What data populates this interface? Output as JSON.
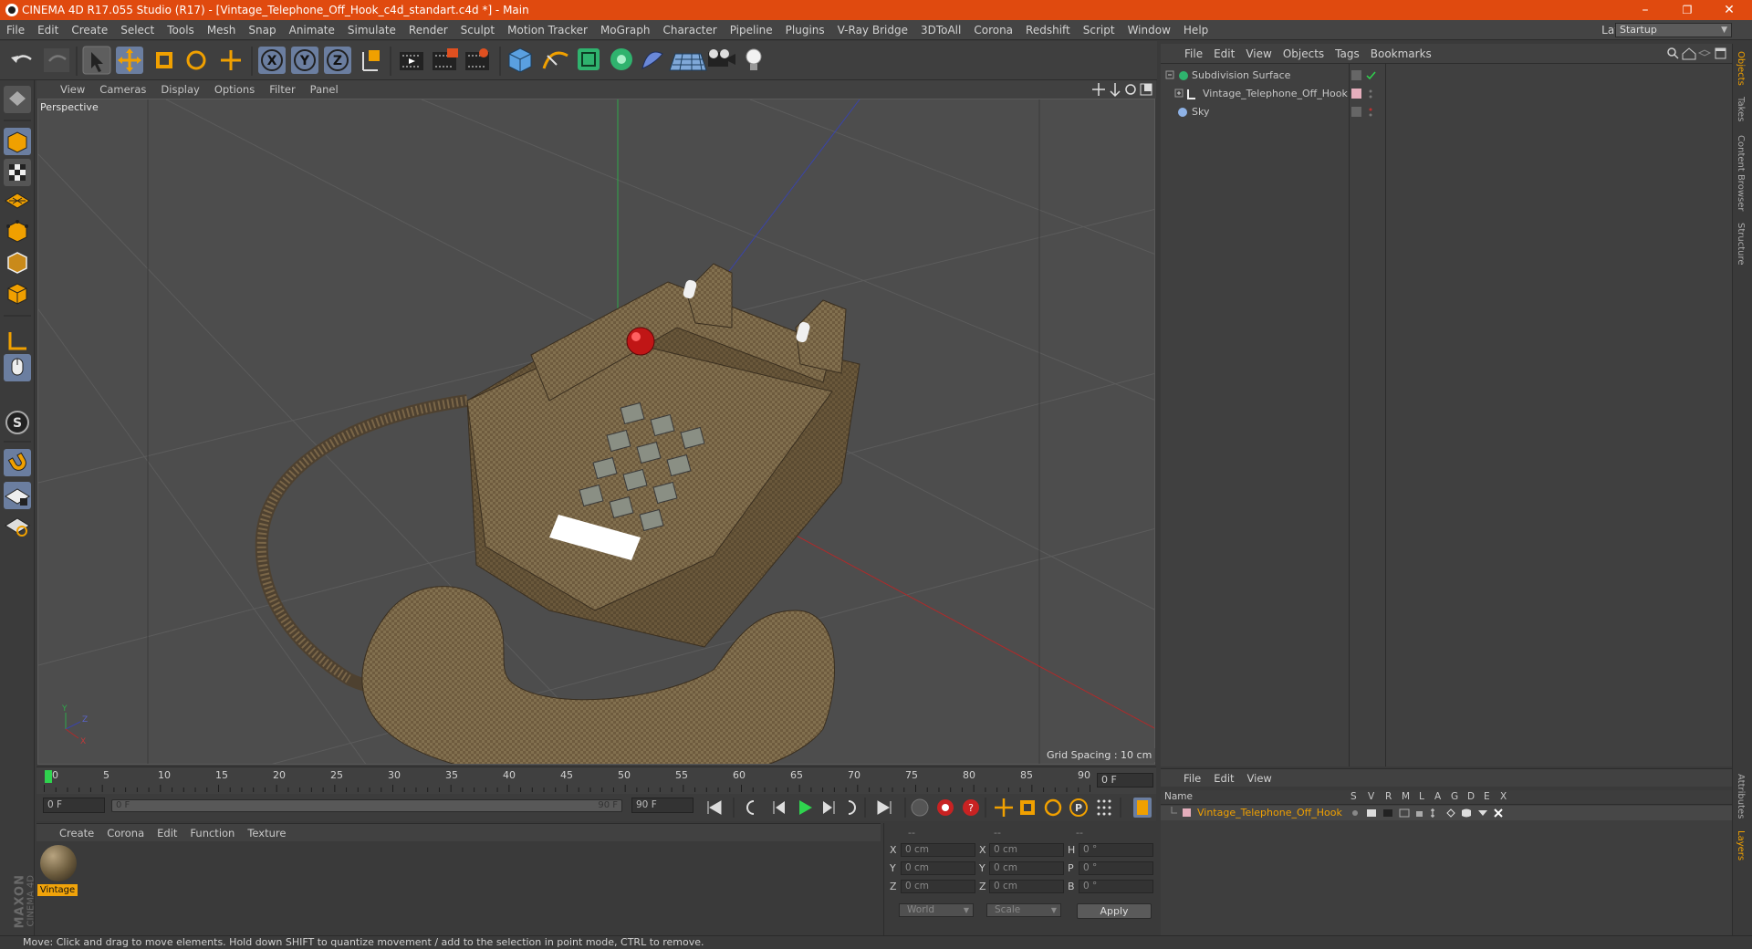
{
  "window": {
    "title": "CINEMA 4D R17.055 Studio (R17) - [Vintage_Telephone_Off_Hook_c4d_standart.c4d *] - Main",
    "minimize": "–",
    "maximize": "❐",
    "close": "✕"
  },
  "menubar": [
    "File",
    "Edit",
    "Create",
    "Select",
    "Tools",
    "Mesh",
    "Snap",
    "Animate",
    "Simulate",
    "Render",
    "Sculpt",
    "Motion Tracker",
    "MoGraph",
    "Character",
    "Pipeline",
    "Plugins",
    "V-Ray Bridge",
    "3DToAll",
    "Corona",
    "Redshift",
    "Script",
    "Window",
    "Help"
  ],
  "layout": {
    "label": "Layout:",
    "value": "Startup"
  },
  "toolbar": {
    "axis_x": "X",
    "axis_y": "Y",
    "axis_z": "Z"
  },
  "viewport": {
    "menu": [
      "View",
      "Cameras",
      "Display",
      "Options",
      "Filter",
      "Panel"
    ],
    "camera_label": "Perspective",
    "grid_spacing": "Grid Spacing : 10 cm"
  },
  "timeline": {
    "ticks": [
      "0",
      "5",
      "10",
      "15",
      "20",
      "25",
      "30",
      "35",
      "40",
      "45",
      "50",
      "55",
      "60",
      "65",
      "70",
      "75",
      "80",
      "85",
      "90"
    ],
    "current_frame": "0 F",
    "start_field": "0 F",
    "slider_start": "0 F",
    "slider_end": "90 F",
    "end_field": "90 F"
  },
  "materials": {
    "menu": [
      "Create",
      "Corona",
      "Edit",
      "Function",
      "Texture"
    ],
    "items": [
      {
        "name": "Vintage"
      }
    ]
  },
  "coordinates": {
    "headers": [
      "--",
      "--",
      "--"
    ],
    "rows": [
      {
        "l1": "X",
        "v1": "0 cm",
        "l2": "X",
        "v2": "0 cm",
        "l3": "H",
        "v3": "0 °"
      },
      {
        "l1": "Y",
        "v1": "0 cm",
        "l2": "Y",
        "v2": "0 cm",
        "l3": "P",
        "v3": "0 °"
      },
      {
        "l1": "Z",
        "v1": "0 cm",
        "l2": "Z",
        "v2": "0 cm",
        "l3": "B",
        "v3": "0 °"
      }
    ],
    "space": "World",
    "mode": "Scale",
    "apply": "Apply"
  },
  "status": "Move: Click and drag to move elements. Hold down SHIFT to quantize movement / add to the selection in point mode, CTRL to remove.",
  "object_manager": {
    "menu": [
      "File",
      "Edit",
      "View",
      "Objects",
      "Tags",
      "Bookmarks"
    ],
    "objects": [
      {
        "name": "Subdivision Surface"
      },
      {
        "name": "Vintage_Telephone_Off_Hook"
      },
      {
        "name": "Sky"
      }
    ]
  },
  "right_tabs": [
    "Objects",
    "Takes",
    "Content Browser",
    "Structure"
  ],
  "right_tabs_bottom": [
    "Attributes",
    "Layers"
  ],
  "layer_manager": {
    "menu": [
      "File",
      "Edit",
      "View"
    ],
    "header_name": "Name",
    "columns": [
      "S",
      "V",
      "R",
      "M",
      "L",
      "A",
      "G",
      "D",
      "E",
      "X"
    ],
    "rows": [
      {
        "name": "Vintage_Telephone_Off_Hook"
      }
    ]
  },
  "logo": {
    "text1": "MAXON",
    "text2": "CINEMA 4D"
  },
  "colors": {
    "accent": "#e04a0f",
    "selection": "#f0a30a",
    "panel": "#3a3a3a",
    "viewport": "#4d4d4d"
  }
}
